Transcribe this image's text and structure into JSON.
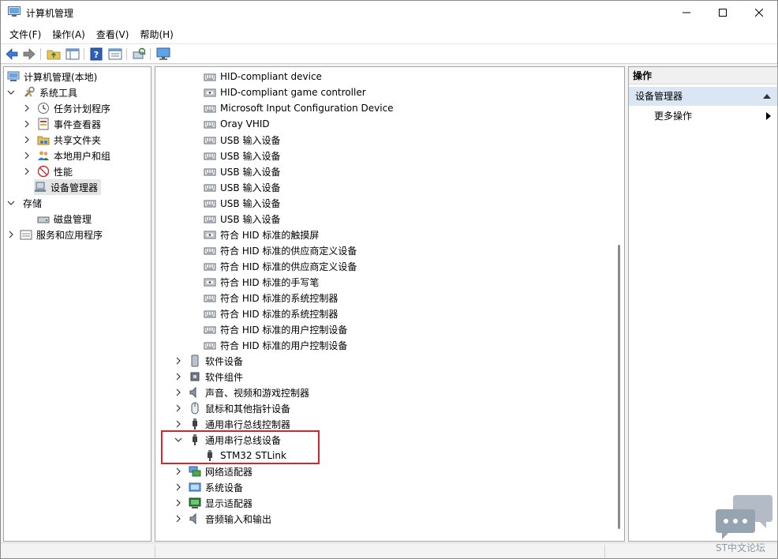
{
  "window": {
    "title": "计算机管理"
  },
  "menu": {
    "items": [
      "文件(F)",
      "操作(A)",
      "查看(V)",
      "帮助(H)"
    ]
  },
  "toolbar": {
    "icons": [
      "back-arrow-icon",
      "forward-arrow-icon",
      "up-folder-icon",
      "show-hide-tree-icon",
      "help-icon",
      "properties-icon",
      "scan-hardware-icon",
      "monitor-icon"
    ]
  },
  "tree": {
    "root": "计算机管理(本地)",
    "system_tools": "系统工具",
    "task_scheduler": "任务计划程序",
    "event_viewer": "事件查看器",
    "shared_folders": "共享文件夹",
    "local_users": "本地用户和组",
    "performance": "性能",
    "device_manager": "设备管理器",
    "storage": "存储",
    "disk_management": "磁盘管理",
    "services_apps": "服务和应用程序"
  },
  "devices": {
    "hid_children": [
      "HID-compliant device",
      "HID-compliant game controller",
      "Microsoft Input Configuration Device",
      "Oray VHID",
      "USB 输入设备",
      "USB 输入设备",
      "USB 输入设备",
      "USB 输入设备",
      "USB 输入设备",
      "USB 输入设备",
      "符合 HID 标准的触摸屏",
      "符合 HID 标准的供应商定义设备",
      "符合 HID 标准的供应商定义设备",
      "符合 HID 标准的手写笔",
      "符合 HID 标准的系统控制器",
      "符合 HID 标准的系统控制器",
      "符合 HID 标准的用户控制设备",
      "符合 HID 标准的用户控制设备"
    ],
    "software_devices": "软件设备",
    "software_components": "软件组件",
    "sound": "声音、视频和游戏控制器",
    "mice": "鼠标和其他指针设备",
    "usb_controllers": "通用串行总线控制器",
    "usb_devices": "通用串行总线设备",
    "stlink": "STM32 STLink",
    "network": "网络适配器",
    "system_devices": "系统设备",
    "display": "显示适配器",
    "audio_io": "音频输入和输出"
  },
  "actions": {
    "header": "操作",
    "section": "设备管理器",
    "more": "更多操作"
  },
  "watermark": {
    "text": "ST中文论坛"
  },
  "colors": {
    "highlight": "#e0202a",
    "section_bg": "#dbe6f4",
    "selected_bg": "#e5e5e5"
  }
}
